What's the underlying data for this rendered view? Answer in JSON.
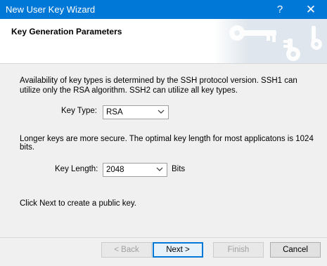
{
  "window": {
    "title": "New User Key Wizard",
    "help_glyph": "?",
    "close_glyph": "✕",
    "accent_color": "#0078d7"
  },
  "header": {
    "heading": "Key Generation Parameters",
    "art_icon": "keys-illustration"
  },
  "main": {
    "intro_text": "Availability of key types is determined by the SSH protocol version. SSH1 can utilize only the RSA algorithm. SSH2 can utilize all key types.",
    "key_type": {
      "label": "Key Type:",
      "value": "RSA"
    },
    "length_hint": "Longer keys are more secure. The optimal key length for most applicatons is 1024 bits.",
    "key_length": {
      "label": "Key Length:",
      "value": "2048",
      "unit": "Bits"
    },
    "next_hint": "Click Next to create a public key."
  },
  "footer": {
    "back_label": "< Back",
    "next_label": "Next >",
    "finish_label": "Finish",
    "cancel_label": "Cancel"
  }
}
